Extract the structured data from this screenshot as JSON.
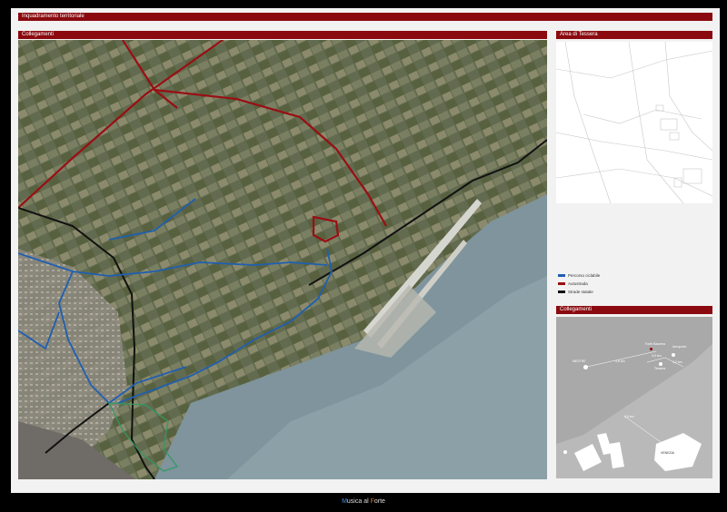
{
  "header": {
    "title": "Inquadramento territoriale"
  },
  "main_map": {
    "title": "Collegamenti"
  },
  "area_map": {
    "title": "Area di Tessera"
  },
  "legend": {
    "items": [
      {
        "label": "Percorso ciclabile",
        "color": "#1f5fb0"
      },
      {
        "label": "Autostrada",
        "color": "#9a0e14"
      },
      {
        "label": "Strade statale",
        "color": "#111111"
      }
    ]
  },
  "connections": {
    "title": "Collegamenti",
    "places": {
      "mestre": "MESTRE",
      "forte_bazzera": "Forte Bazzera",
      "aeroporto": "Aeroporto",
      "tessera": "Tessera",
      "venezia": "VENEZIA"
    },
    "distances": {
      "d1": "4,5 km",
      "d2": "3,9 km",
      "d3": "4,2 km",
      "d4": "6,5 km"
    }
  },
  "footer": {
    "brand_part1": "M",
    "brand_part2": "usica al ",
    "brand_part3": "F",
    "brand_part4": "orte"
  },
  "colors": {
    "accent": "#8a0a0f",
    "cycle": "#1f5fb0",
    "motorway": "#9a0e14",
    "state_road": "#111111",
    "water": "#8a9aa3"
  }
}
